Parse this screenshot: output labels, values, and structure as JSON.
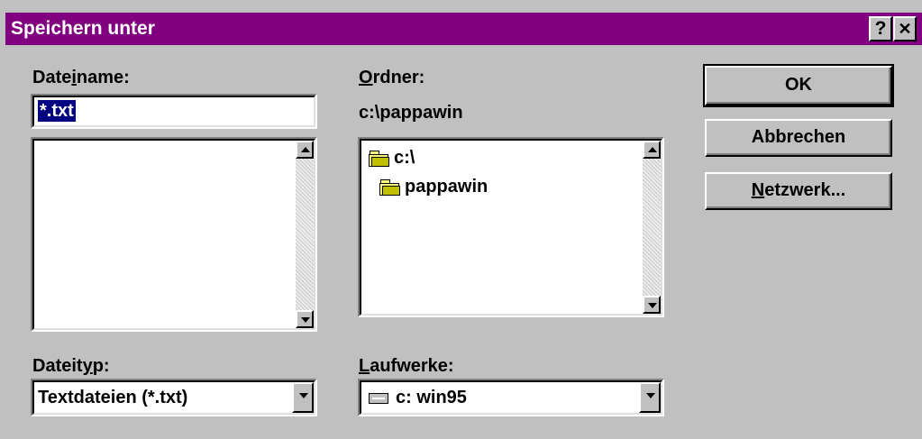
{
  "dialog": {
    "title": "Speichern unter",
    "help_glyph": "?",
    "close_glyph": "✕"
  },
  "filename": {
    "label_pre": "Date",
    "label_accel": "i",
    "label_post": "name:",
    "value": "*.txt"
  },
  "folder": {
    "label_accel": "O",
    "label_post": "rdner:",
    "path": "c:\\pappawin",
    "tree": [
      {
        "name": "c:\\",
        "icon": "open-folder-icon"
      },
      {
        "name": "pappawin",
        "icon": "open-folder-icon"
      }
    ]
  },
  "filetype": {
    "label_pre": "Dateit",
    "label_accel": "y",
    "label_post": "p:",
    "selected": "Textdateien (*.txt)"
  },
  "drives": {
    "label_accel": "L",
    "label_post": "aufwerke:",
    "selected": "c: win95",
    "icon": "hard-drive-icon"
  },
  "buttons": {
    "ok": "OK",
    "cancel": "Abbrechen",
    "network_accel": "N",
    "network_post": "etzwerk..."
  },
  "colors": {
    "titlebar": "#800080",
    "face": "#c0c0c0",
    "selection": "#000080"
  }
}
